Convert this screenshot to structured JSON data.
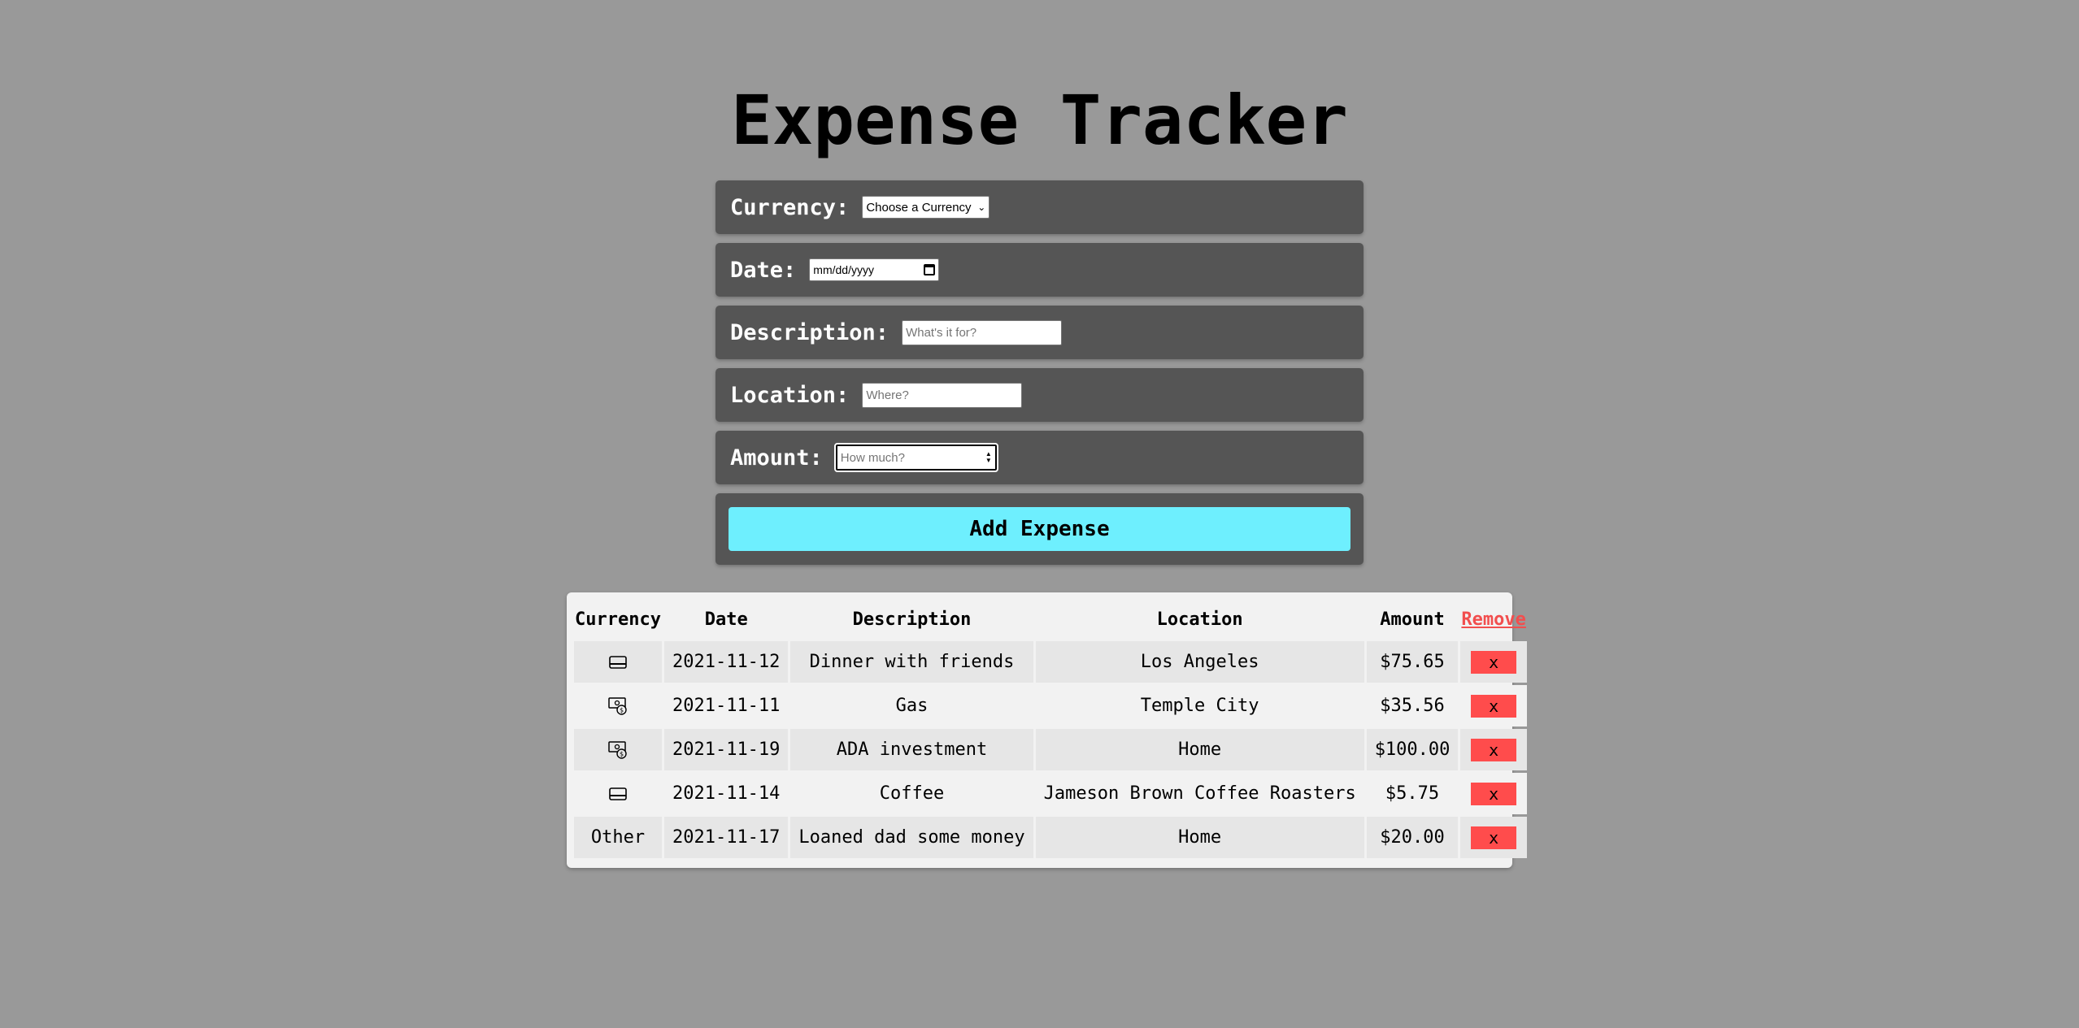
{
  "title": "Expense Tracker",
  "form": {
    "currency_label": "Currency:",
    "currency_value": "Choose a Currency",
    "date_label": "Date:",
    "date_placeholder": "mm/dd/yyyy",
    "description_label": "Description:",
    "description_placeholder": "What's it for?",
    "location_label": "Location:",
    "location_placeholder": "Where?",
    "amount_label": "Amount:",
    "amount_placeholder": "How much?",
    "submit_label": "Add Expense"
  },
  "table": {
    "headers": {
      "currency": "Currency",
      "date": "Date",
      "description": "Description",
      "location": "Location",
      "amount": "Amount",
      "remove": "Remove"
    },
    "rows": [
      {
        "currency": "card-icon",
        "date": "2021-11-12",
        "description": "Dinner with friends",
        "location": "Los Angeles",
        "amount": "$75.65",
        "remove": "x"
      },
      {
        "currency": "cash-icon",
        "date": "2021-11-11",
        "description": "Gas",
        "location": "Temple City",
        "amount": "$35.56",
        "remove": "x"
      },
      {
        "currency": "cash-icon",
        "date": "2021-11-19",
        "description": "ADA investment",
        "location": "Home",
        "amount": "$100.00",
        "remove": "x"
      },
      {
        "currency": "card-icon",
        "date": "2021-11-14",
        "description": "Coffee",
        "location": "Jameson Brown Coffee Roasters",
        "amount": "$5.75",
        "remove": "x"
      },
      {
        "currency": "Other",
        "date": "2021-11-17",
        "description": "Loaned dad some money",
        "location": "Home",
        "amount": "$20.00",
        "remove": "x"
      }
    ]
  },
  "colors": {
    "background": "#999999",
    "panel": "#555555",
    "accent_button": "#6eeffe",
    "remove_red": "#ff4c4c"
  }
}
